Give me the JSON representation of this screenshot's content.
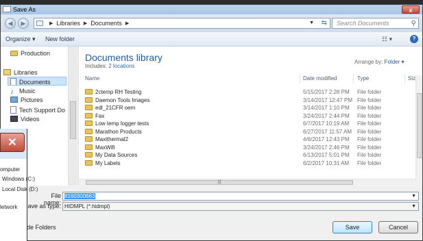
{
  "dialog": {
    "title": "Save As",
    "close_label": "x"
  },
  "address": {
    "crumbs": [
      "Libraries",
      "Documents"
    ],
    "search_placeholder": "Search Documents"
  },
  "toolbar": {
    "organize": "Organize ▾",
    "new_folder": "New folder"
  },
  "nav": {
    "items": [
      "Production",
      "Libraries",
      "Documents",
      "Music",
      "Pictures",
      "Tech Support Do",
      "Videos"
    ]
  },
  "library": {
    "title": "Documents library",
    "includes_label": "Includes:",
    "includes_link": "2 locations",
    "arrange_label": "Arrange by:",
    "arrange_value": "Folder ▾"
  },
  "columns": {
    "name": "Name",
    "date": "Date modified",
    "type": "Type",
    "size": "Size"
  },
  "files": [
    {
      "name": "2ctemp RH Testing",
      "date": "5/15/2017 2:28 PM",
      "type": "File folder"
    },
    {
      "name": "Daemon Tools Images",
      "date": "3/14/2017 12:47 PM",
      "type": "File folder"
    },
    {
      "name": "edl_21CFR oem",
      "date": "3/14/2017 1:10 PM",
      "type": "File folder"
    },
    {
      "name": "Fax",
      "date": "3/24/2017 2:44 PM",
      "type": "File folder"
    },
    {
      "name": "Low temp logger tests",
      "date": "6/7/2017 10:19 AM",
      "type": "File folder"
    },
    {
      "name": "Marathon Products",
      "date": "6/27/2017 11:57 AM",
      "type": "File folder"
    },
    {
      "name": "Maxithermal2",
      "date": "4/6/2017 12:43 PM",
      "type": "File folder"
    },
    {
      "name": "MaxWifi",
      "date": "3/24/2017 2:46 PM",
      "type": "File folder"
    },
    {
      "name": "My Data Sources",
      "date": "6/13/2017 5:01 PM",
      "type": "File folder"
    },
    {
      "name": "My Labels",
      "date": "6/2/2017 10:31 AM",
      "type": "File folder"
    }
  ],
  "form": {
    "file_name_label": "File name:",
    "file_name_value": "8160300663",
    "save_type_label": "Save as type:",
    "save_type_value": "HIDMPL (*.hidmpl)"
  },
  "footer": {
    "hide_folders": "de Folders",
    "save": "Save",
    "cancel": "Cancel"
  },
  "overlay": {
    "items": [
      "omputer",
      "Windows (C:)",
      "Local Disk (D:)",
      "letwork"
    ]
  },
  "colors": {
    "accent": "#1e5aa6",
    "selection": "#3399ff"
  }
}
